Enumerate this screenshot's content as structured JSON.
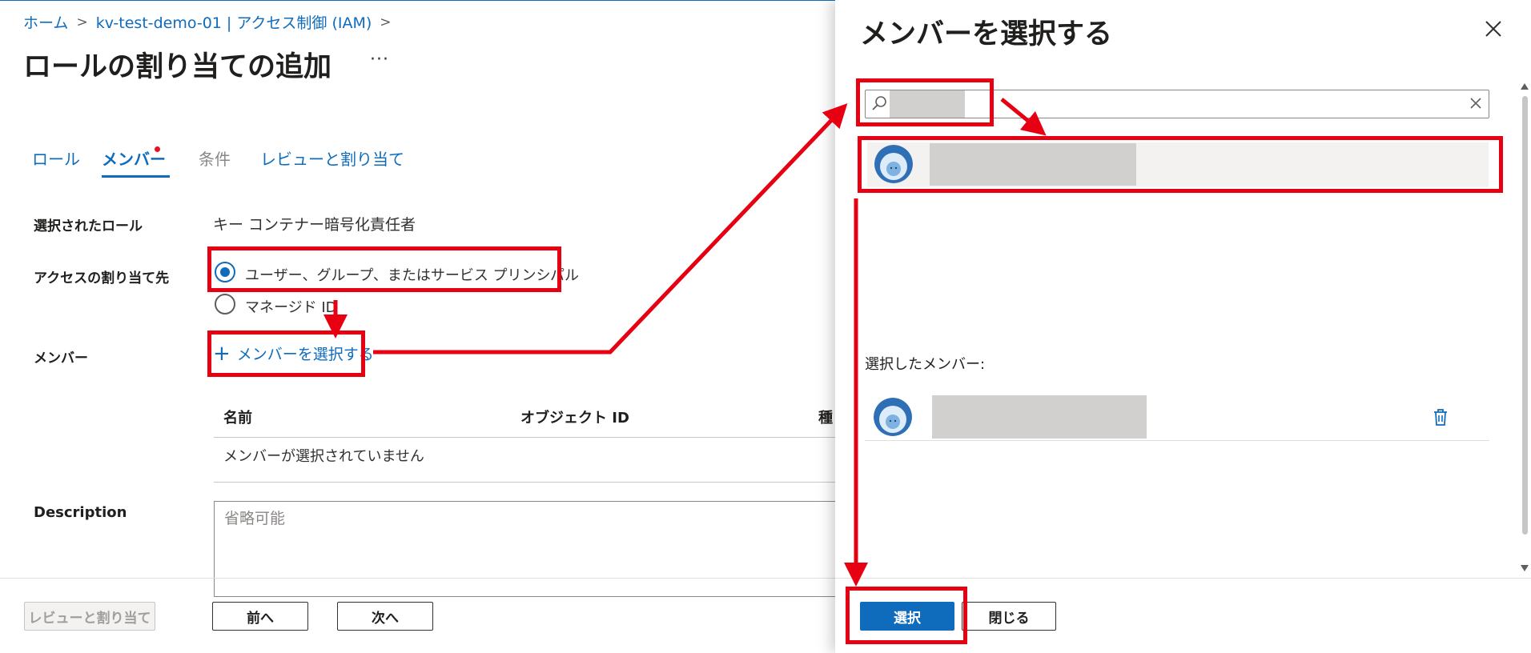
{
  "breadcrumb": {
    "home": "ホーム",
    "resource": "kv-test-demo-01 | アクセス制御 (IAM)",
    "separator": ">"
  },
  "page": {
    "title": "ロールの割り当ての追加",
    "more": "···"
  },
  "tabs": [
    {
      "label": "ロール"
    },
    {
      "label": "メンバー"
    },
    {
      "label": "条件"
    },
    {
      "label": "レビューと割り当て"
    }
  ],
  "form": {
    "selected_role_label": "選択されたロール",
    "selected_role_value": "キー コンテナー暗号化責任者",
    "assign_to_label": "アクセスの割り当て先",
    "option_user": "ユーザー、グループ、またはサービス プリンシパル",
    "option_managed": "マネージド ID",
    "members_label": "メンバー",
    "select_members_link": "メンバーを選択する",
    "table_headers": [
      "名前",
      "オブジェクト ID",
      "種"
    ],
    "table_empty": "メンバーが選択されていません",
    "description_label": "Description",
    "description_placeholder": "省略可能"
  },
  "footer": {
    "review": "レビューと割り当て",
    "prev": "前へ",
    "next": "次へ"
  },
  "panel": {
    "title": "メンバーを選択する",
    "selected_members_label": "選択したメンバー:",
    "select_button": "選択",
    "close_button": "閉じる"
  },
  "colors": {
    "accent": "#0f6cbd",
    "annotation": "#e60012"
  }
}
